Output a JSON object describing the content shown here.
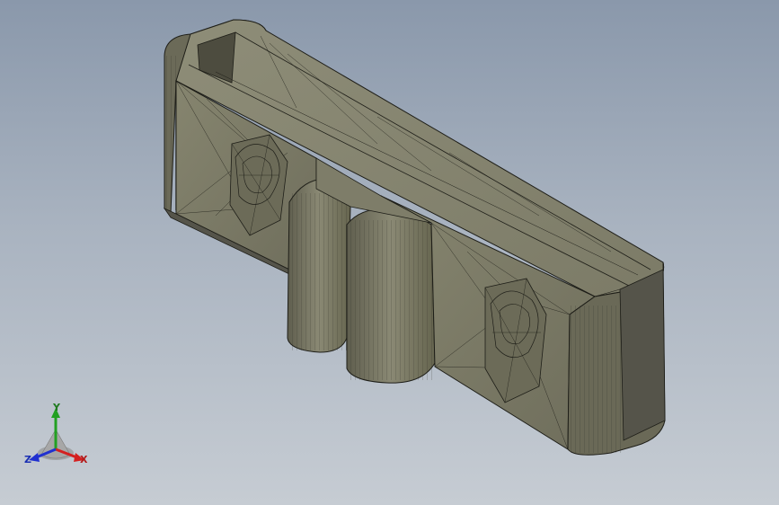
{
  "triad": {
    "y_label": "Y",
    "x_label": "X",
    "z_label": "Z"
  },
  "colors": {
    "background_top": "#8a98ab",
    "background_bottom": "#c6ccd3",
    "model_face": "#7a7966",
    "model_face_light": "#8e8d79",
    "model_face_dark": "#5f5e4e",
    "edge": "#1e1e18",
    "axis_x": "#d42020",
    "axis_y": "#22a022",
    "axis_z": "#2030d0"
  }
}
